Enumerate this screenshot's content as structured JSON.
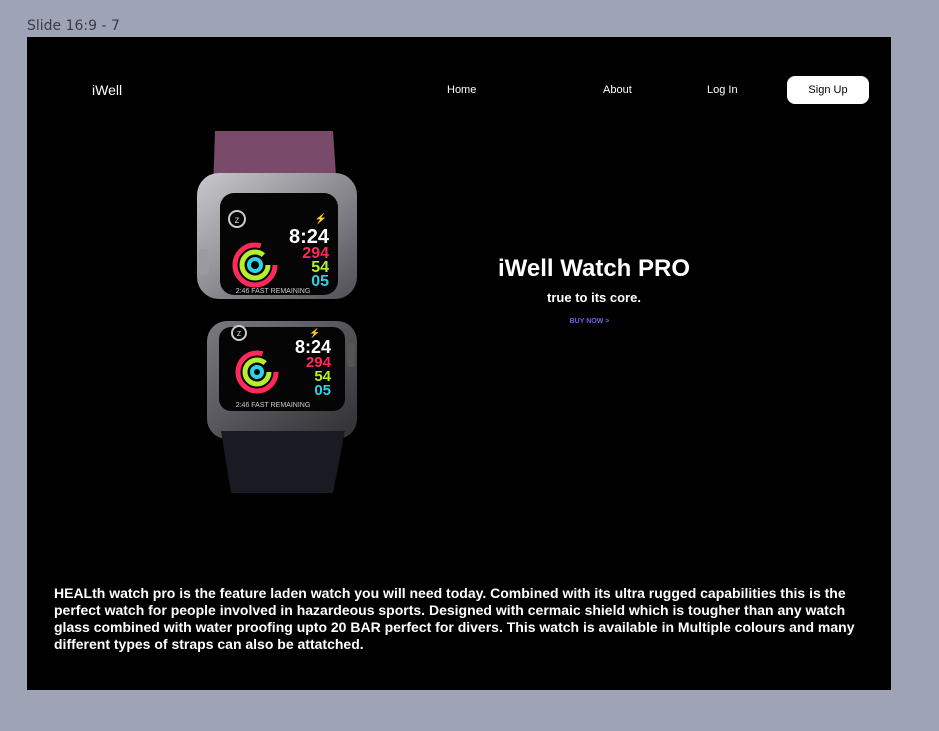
{
  "frame_label": "Slide 16:9 - 7",
  "nav": {
    "brand": "iWell",
    "home": "Home",
    "about": "About",
    "login": "Log In",
    "signup": "Sign Up"
  },
  "hero": {
    "title": "iWell Watch PRO",
    "subtitle": "true to its core.",
    "cta": "BUY NOW >"
  },
  "watch": {
    "time": "8:24",
    "move": "294",
    "exercise": "54",
    "stand": "05",
    "status": "2:46 FAST REMAINING",
    "band_top_color": "#7a4a6a",
    "band_bottom_color": "#1a1a22",
    "move_color": "#ff2a5a",
    "exercise_color": "#b6f02a",
    "stand_color": "#2fd3e6"
  },
  "description": "HEALth watch pro is the feature laden watch you will need today. Combined with its ultra rugged capabilities this is the perfect watch for people involved in hazardeous sports. Designed with cermaic shield which is tougher than any watch glass combined with water proofing upto 20 BAR perfect for divers. This watch is available in Multiple colours and many different types of straps can also be attatched."
}
